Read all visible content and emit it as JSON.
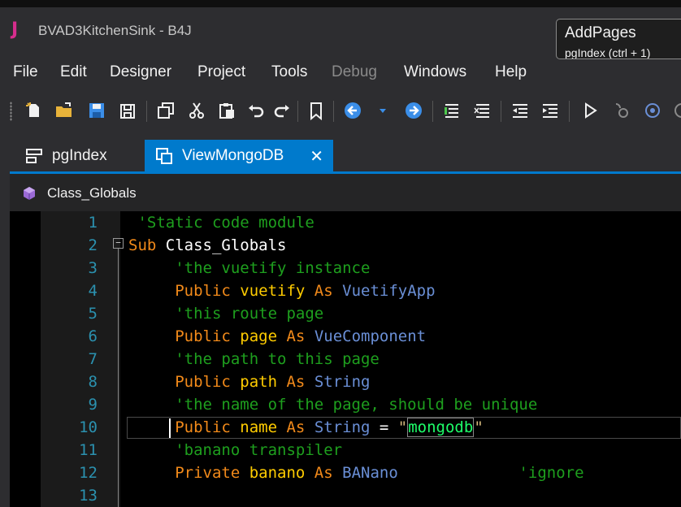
{
  "window": {
    "logo": "J",
    "title": "BVAD3KitchenSink - B4J",
    "tooltip": {
      "line1": "AddPages",
      "line2": "pgIndex  (ctrl + 1)"
    }
  },
  "menu": [
    {
      "label": "File",
      "enabled": true
    },
    {
      "label": "Edit",
      "enabled": true
    },
    {
      "label": "Designer",
      "enabled": true
    },
    {
      "label": "Project",
      "enabled": true
    },
    {
      "label": "Tools",
      "enabled": true
    },
    {
      "label": "Debug",
      "enabled": false
    },
    {
      "label": "Windows",
      "enabled": true
    },
    {
      "label": "Help",
      "enabled": true
    }
  ],
  "toolbar_icons": [
    "new-file-icon",
    "open-folder-icon",
    "save-icon",
    "save-all-icon",
    "copy-icon",
    "cut-icon",
    "paste-icon",
    "undo-icon",
    "redo-icon",
    "bookmark-icon",
    "nav-back-icon",
    "dropdown-arrow-icon",
    "nav-forward-icon",
    "comment-icon",
    "uncomment-icon",
    "outdent-icon",
    "indent-icon",
    "run-icon",
    "debug-icon",
    "step-icon"
  ],
  "tabs": [
    {
      "label": "pgIndex",
      "active": false,
      "icon": "designer-layout-icon"
    },
    {
      "label": "ViewMongoDB",
      "active": true,
      "icon": "view-window-icon",
      "close": "✕"
    }
  ],
  "breadcrumb": {
    "label": "Class_Globals",
    "icon": "module-cube-icon"
  },
  "editor": {
    "current_line": 10,
    "lines": [
      {
        "n": "1",
        "tokens": [
          {
            "t": " 'Static code module",
            "c": "cm"
          }
        ]
      },
      {
        "n": "2",
        "tokens": [
          {
            "t": "Sub ",
            "c": "kw"
          },
          {
            "t": "Class_Globals",
            "c": "wh"
          }
        ]
      },
      {
        "n": "3",
        "tokens": [
          {
            "t": "     'the vuetify instance",
            "c": "cm"
          }
        ]
      },
      {
        "n": "4",
        "tokens": [
          {
            "t": "     Public ",
            "c": "kw"
          },
          {
            "t": "vuetify ",
            "c": "id"
          },
          {
            "t": "As ",
            "c": "kw"
          },
          {
            "t": "VuetifyApp",
            "c": "typ"
          }
        ]
      },
      {
        "n": "5",
        "tokens": [
          {
            "t": "     'this route page",
            "c": "cm"
          }
        ]
      },
      {
        "n": "6",
        "tokens": [
          {
            "t": "     Public ",
            "c": "kw"
          },
          {
            "t": "page ",
            "c": "id"
          },
          {
            "t": "As ",
            "c": "kw"
          },
          {
            "t": "VueComponent",
            "c": "typ"
          }
        ]
      },
      {
        "n": "7",
        "tokens": [
          {
            "t": "     'the path to this page",
            "c": "cm"
          }
        ]
      },
      {
        "n": "8",
        "tokens": [
          {
            "t": "     Public ",
            "c": "kw"
          },
          {
            "t": "path ",
            "c": "id"
          },
          {
            "t": "As ",
            "c": "kw"
          },
          {
            "t": "String",
            "c": "typ"
          }
        ]
      },
      {
        "n": "9",
        "tokens": [
          {
            "t": "     'the name of the page, should be unique",
            "c": "cm"
          }
        ]
      },
      {
        "n": "10",
        "tokens": [
          {
            "t": "     Public ",
            "c": "kw"
          },
          {
            "t": "name ",
            "c": "id"
          },
          {
            "t": "As ",
            "c": "kw"
          },
          {
            "t": "String ",
            "c": "typ"
          },
          {
            "t": "= ",
            "c": "wh"
          },
          {
            "t": "\"",
            "c": "str"
          },
          {
            "t": "mongodb",
            "c": "strsel"
          },
          {
            "t": "\"",
            "c": "str"
          }
        ]
      },
      {
        "n": "11",
        "tokens": [
          {
            "t": "     'banano transpiler",
            "c": "cm"
          }
        ]
      },
      {
        "n": "12",
        "tokens": [
          {
            "t": "     Private ",
            "c": "kw"
          },
          {
            "t": "banano ",
            "c": "id"
          },
          {
            "t": "As ",
            "c": "kw"
          },
          {
            "t": "BANano",
            "c": "typ"
          },
          {
            "t": "             'ignore",
            "c": "cm"
          }
        ]
      },
      {
        "n": "13",
        "tokens": []
      }
    ]
  }
}
